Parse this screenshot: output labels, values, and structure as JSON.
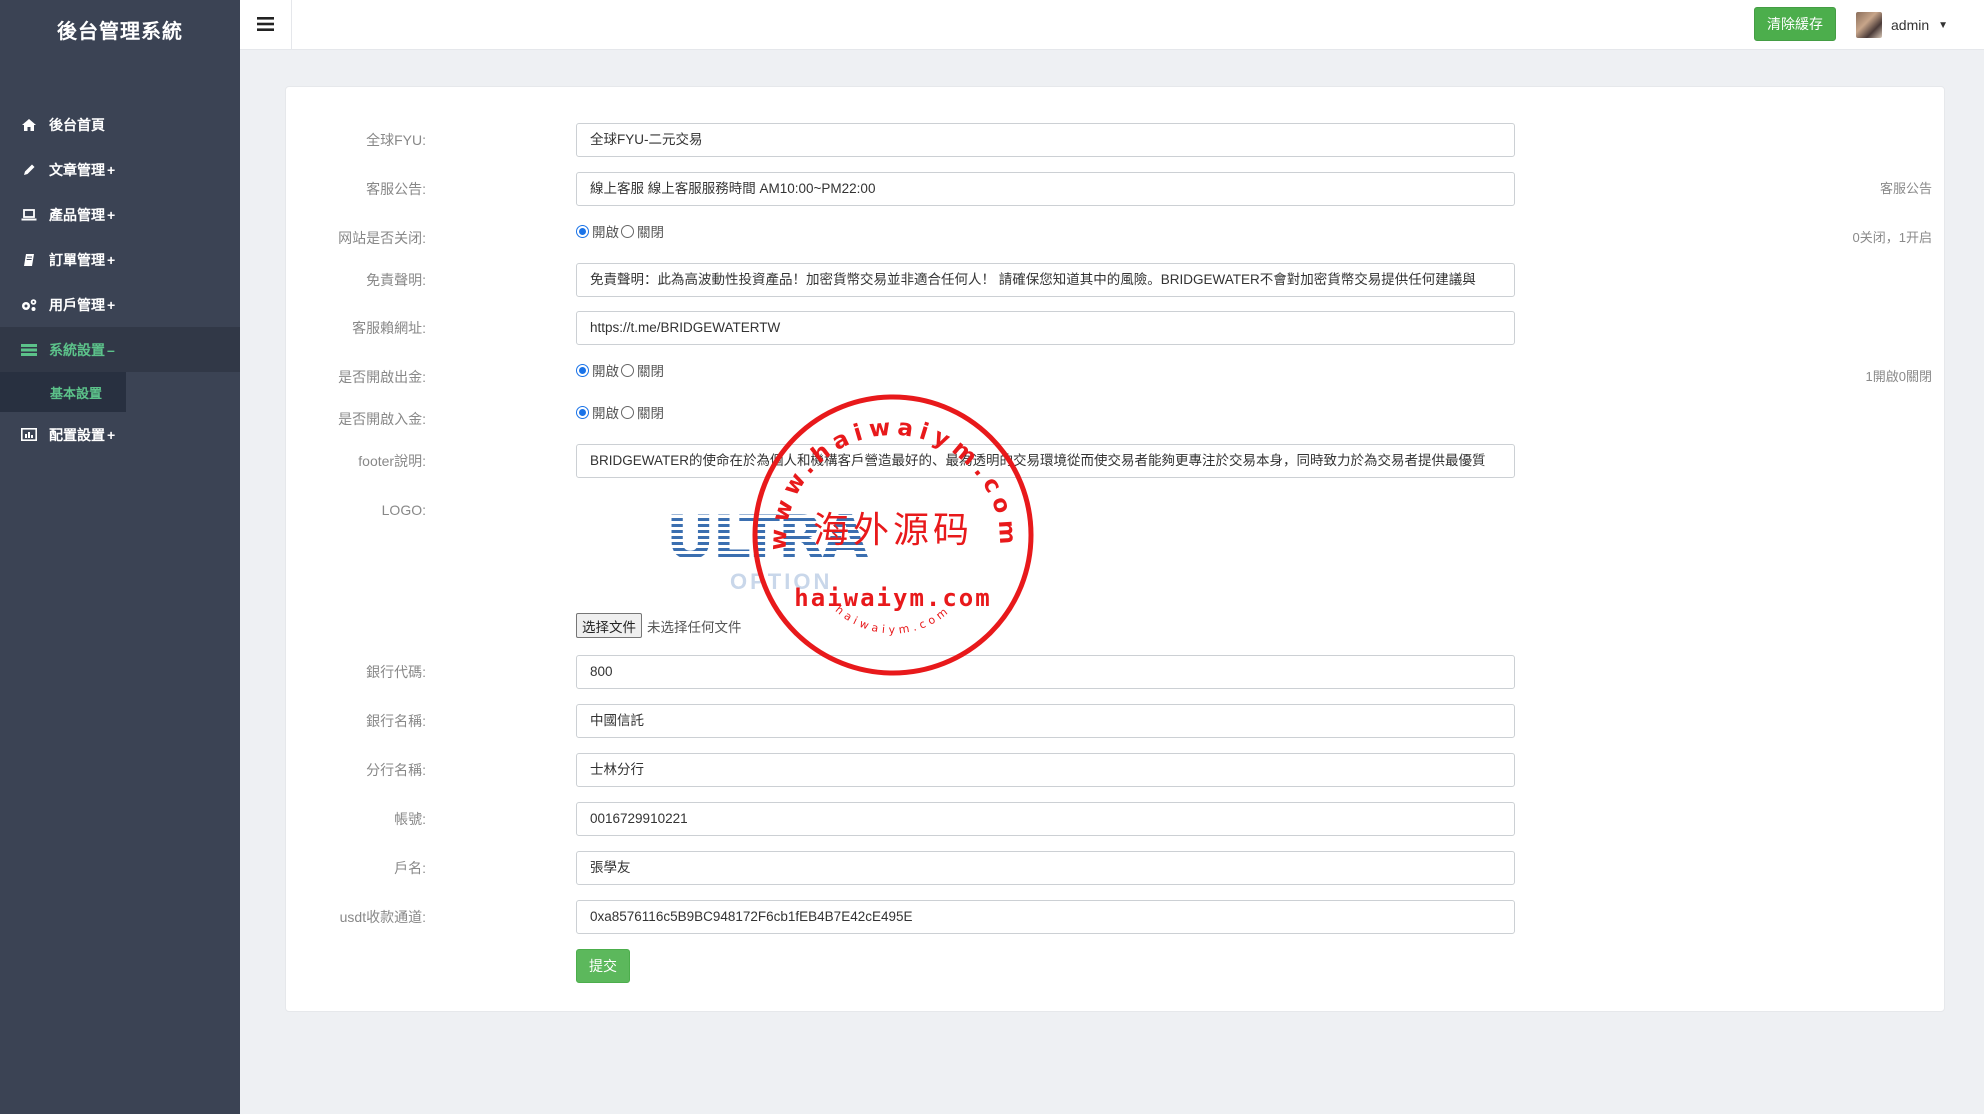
{
  "app": {
    "title": "後台管理系統"
  },
  "sidebar": {
    "items": [
      {
        "label": "後台首頁",
        "suffix": "",
        "icon": "home-icon"
      },
      {
        "label": "文章管理",
        "suffix": "+",
        "icon": "pencil-icon"
      },
      {
        "label": "產品管理",
        "suffix": "+",
        "icon": "laptop-icon"
      },
      {
        "label": "訂單管理",
        "suffix": "+",
        "icon": "book-icon"
      },
      {
        "label": "用戶管理",
        "suffix": "+",
        "icon": "gears-icon"
      },
      {
        "label": "系統設置",
        "suffix": "–",
        "icon": "list-icon",
        "active": true
      },
      {
        "label": "配置設置",
        "suffix": "+",
        "icon": "chart-icon"
      }
    ],
    "sub_item": "基本設置"
  },
  "topbar": {
    "menu_icon": "hamburger-icon",
    "clear_cache": "清除緩存",
    "user_name": "admin"
  },
  "form": {
    "site_name": {
      "label": "全球FYU:",
      "value": "全球FYU-二元交易"
    },
    "notice": {
      "label": "客服公告:",
      "value": "線上客服 線上客服服務時間 AM10:00~PM22:00",
      "help": "客服公告"
    },
    "site_closed": {
      "label": "网站是否关闭:",
      "opt_on": "開啟",
      "opt_off": "關閉",
      "selected": "on",
      "help": "0关闭，1开启"
    },
    "disclaimer": {
      "label": "免責聲明:",
      "value": "免責聲明：此為高波動性投資產品！加密貨幣交易並非適合任何人！ 請確保您知道其中的風險。BRIDGEWATER不會對加密貨幣交易提供任何建議與"
    },
    "service_url": {
      "label": "客服賴網址:",
      "value": "https://t.me/BRIDGEWATERTW"
    },
    "withdraw": {
      "label": "是否開啟出金:",
      "opt_on": "開啟",
      "opt_off": "關閉",
      "selected": "on",
      "help": "1開啟0關閉"
    },
    "deposit": {
      "label": "是否開啟入金:",
      "opt_on": "開啟",
      "opt_off": "關閉",
      "selected": "on"
    },
    "footer": {
      "label": "footer說明:",
      "value": "BRIDGEWATER的使命在於為個人和機構客戶營造最好的、最為透明的交易環境從而使交易者能夠更專注於交易本身，同時致力於為交易者提供最優質"
    },
    "logo": {
      "label": "LOGO:",
      "word": "ULTRA",
      "sub": "OPTION",
      "file_button": "选择文件",
      "file_status": "未选择任何文件"
    },
    "bank_code": {
      "label": "銀行代碼:",
      "value": "800"
    },
    "bank_name": {
      "label": "銀行名稱:",
      "value": "中國信託"
    },
    "branch": {
      "label": "分行名稱:",
      "value": "士林分行"
    },
    "account": {
      "label": "帳號:",
      "value": "0016729910221"
    },
    "holder": {
      "label": "戶名:",
      "value": "張學友"
    },
    "usdt": {
      "label": "usdt收款通道:",
      "value": "0xa8576116c5B9BC948172F6cb1fEB4B7E42cE495E"
    },
    "submit": "提交"
  },
  "watermark": {
    "top_arc": "www.haiwaiym.com",
    "center": "海外源码",
    "mid": "haiwaiym.com",
    "bottom_arc": "haiwaiym.com",
    "color": "#e8191b"
  },
  "colors": {
    "sidebar": "#3b4354",
    "accent": "#5cc28a",
    "button": "#5cb85c"
  }
}
